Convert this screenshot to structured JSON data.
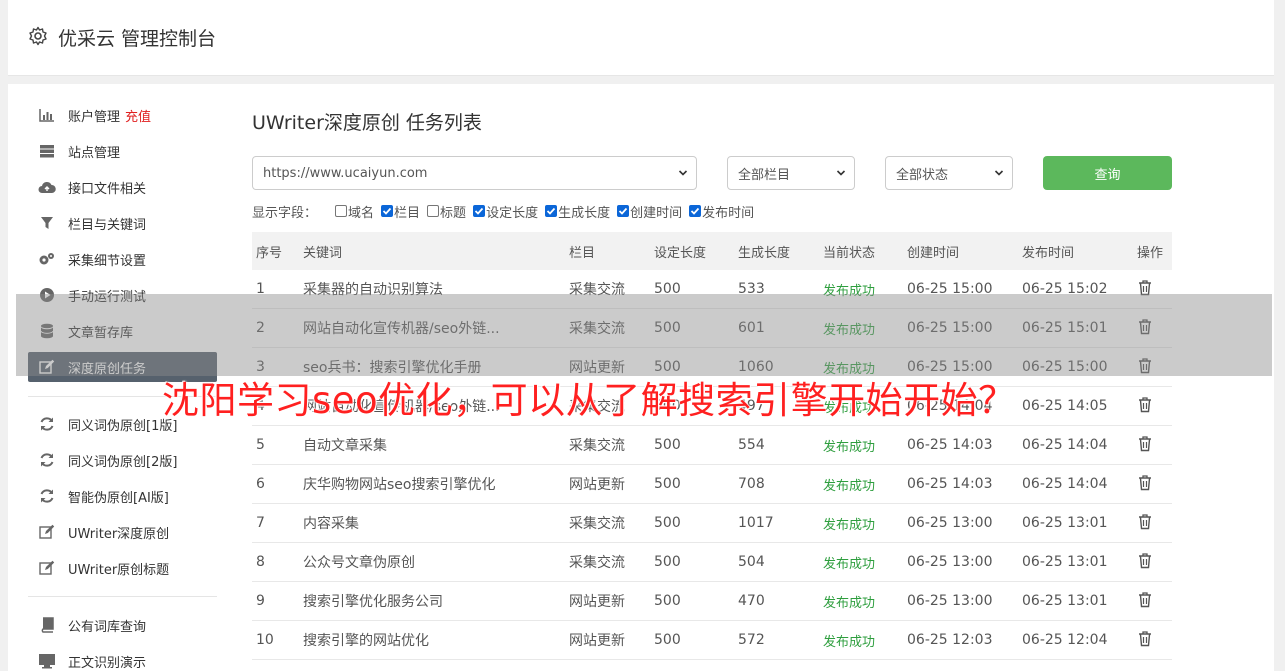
{
  "app": {
    "title": "优采云 管理控制台"
  },
  "sidebar": {
    "items": [
      {
        "label": "账户管理",
        "badge": "充值",
        "icon": "bar-chart-icon"
      },
      {
        "label": "站点管理",
        "icon": "server-icon"
      },
      {
        "label": "接口文件相关",
        "icon": "cloud-upload-icon"
      },
      {
        "label": "栏目与关键词",
        "icon": "filter-icon"
      },
      {
        "label": "采集细节设置",
        "icon": "gears-icon"
      },
      {
        "label": "手动运行测试",
        "icon": "play-circle-icon"
      },
      {
        "label": "文章暂存库",
        "icon": "database-icon"
      },
      {
        "label": "深度原创任务",
        "icon": "edit-icon"
      },
      {
        "label": "同义词伪原创[1版]",
        "icon": "refresh-icon"
      },
      {
        "label": "同义词伪原创[2版]",
        "icon": "refresh-icon"
      },
      {
        "label": "智能伪原创[AI版]",
        "icon": "refresh-icon"
      },
      {
        "label": "UWriter深度原创",
        "icon": "edit-icon"
      },
      {
        "label": "UWriter原创标题",
        "icon": "edit-icon"
      },
      {
        "label": "公有词库查询",
        "icon": "book-icon"
      },
      {
        "label": "正文识别演示",
        "icon": "monitor-icon"
      }
    ]
  },
  "main": {
    "title": "UWriter深度原创 任务列表",
    "site_select": "https://www.ucaiyun.com",
    "column_select": "全部栏目",
    "status_select": "全部状态",
    "query_label": "查询",
    "fields_label": "显示字段：",
    "fields": [
      {
        "label": "域名",
        "checked": false
      },
      {
        "label": "栏目",
        "checked": true
      },
      {
        "label": "标题",
        "checked": false
      },
      {
        "label": "设定长度",
        "checked": true
      },
      {
        "label": "生成长度",
        "checked": true
      },
      {
        "label": "创建时间",
        "checked": true
      },
      {
        "label": "发布时间",
        "checked": true
      }
    ],
    "table": {
      "headers": [
        "序号",
        "关键词",
        "栏目",
        "设定长度",
        "生成长度",
        "当前状态",
        "创建时间",
        "发布时间",
        "操作"
      ],
      "rows": [
        [
          "1",
          "采集器的自动识别算法",
          "采集交流",
          "500",
          "533",
          "发布成功",
          "06-25 15:00",
          "06-25 15:02"
        ],
        [
          "2",
          "网站自动化宣传机器/seo外链...",
          "采集交流",
          "500",
          "601",
          "发布成功",
          "06-25 15:00",
          "06-25 15:01"
        ],
        [
          "3",
          "seo兵书：搜索引擎优化手册",
          "网站更新",
          "500",
          "1060",
          "发布成功",
          "06-25 15:00",
          "06-25 15:00"
        ],
        [
          "4",
          "网站自动化宣传机器/seo外链...",
          "采集交流",
          "500",
          "497",
          "发布成功",
          "06-25 14:04",
          "06-25 14:05"
        ],
        [
          "5",
          "自动文章采集",
          "采集交流",
          "500",
          "554",
          "发布成功",
          "06-25 14:03",
          "06-25 14:04"
        ],
        [
          "6",
          "庆华购物网站seo搜索引擎优化",
          "网站更新",
          "500",
          "708",
          "发布成功",
          "06-25 14:03",
          "06-25 14:04"
        ],
        [
          "7",
          "内容采集",
          "采集交流",
          "500",
          "1017",
          "发布成功",
          "06-25 13:00",
          "06-25 13:01"
        ],
        [
          "8",
          "公众号文章伪原创",
          "采集交流",
          "500",
          "504",
          "发布成功",
          "06-25 13:00",
          "06-25 13:01"
        ],
        [
          "9",
          "搜索引擎优化服务公司",
          "网站更新",
          "500",
          "470",
          "发布成功",
          "06-25 13:00",
          "06-25 13:01"
        ],
        [
          "10",
          "搜索引擎的网站优化",
          "网站更新",
          "500",
          "572",
          "发布成功",
          "06-25 12:03",
          "06-25 12:04"
        ]
      ]
    }
  },
  "overlay": {
    "headline": "沈阳学习seo优化，可以从了解搜索引擎开始开始？"
  },
  "colors": {
    "active_nav": "#56616d",
    "query_button": "#5cb85c",
    "status_ok": "#2e9e3e",
    "headline": "#ff2020",
    "badge": "#e02020"
  }
}
